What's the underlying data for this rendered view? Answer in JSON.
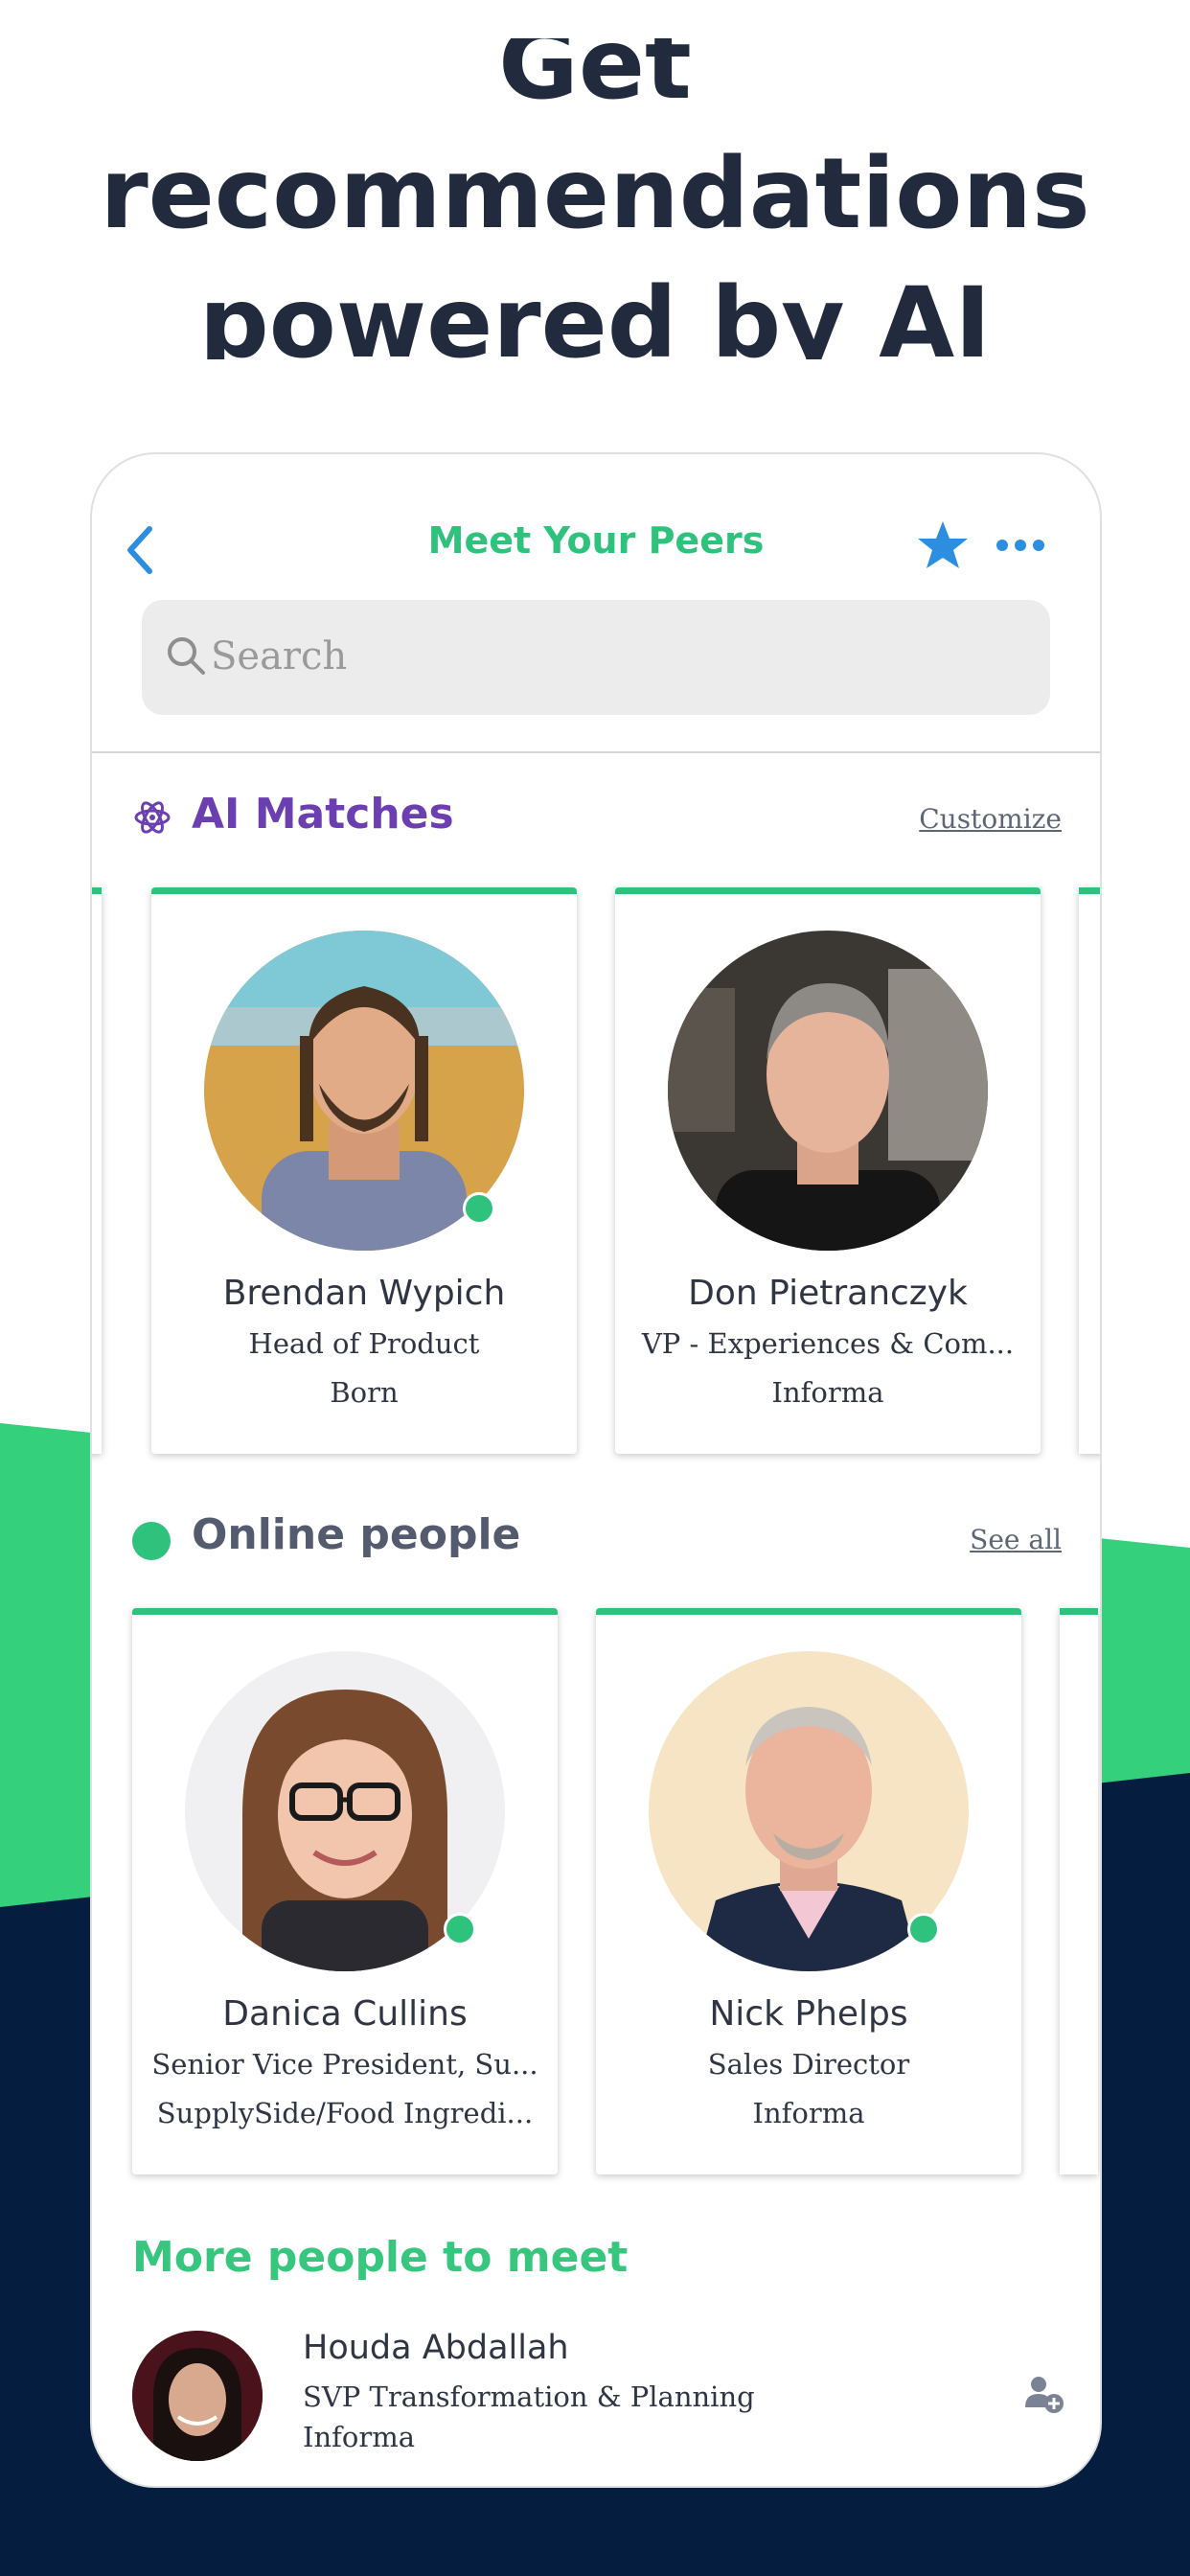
{
  "headline": {
    "line1": "Get",
    "line2": "recommendations",
    "line3": "powered by AI"
  },
  "nav": {
    "title": "Meet Your Peers"
  },
  "search": {
    "placeholder": "Search"
  },
  "ai_matches": {
    "title": "AI Matches",
    "link": "Customize",
    "cards": [
      {
        "name": "Brendan Wypich",
        "role": "Head of Product",
        "company": "Born",
        "online": true
      },
      {
        "name": "Don Pietranczyk",
        "role": "VP - Experiences & Com...",
        "company": "Informa",
        "online": false
      }
    ]
  },
  "online_people": {
    "title": "Online people",
    "link": "See all",
    "cards": [
      {
        "name": "Danica Cullins",
        "role": "Senior Vice President, Su...",
        "company": "SupplySide/Food Ingredi...",
        "online": true
      },
      {
        "name": "Nick Phelps",
        "role": "Sales Director",
        "company": "Informa",
        "online": true
      }
    ]
  },
  "more_people": {
    "title": "More people to meet",
    "people": [
      {
        "name": "Houda Abdallah",
        "role": "SVP Transformation & Planning",
        "company": "Informa"
      }
    ]
  },
  "colors": {
    "green": "#2fc27d",
    "purple": "#6b3fb0",
    "blue": "#2d8ee0",
    "navy": "#051e40",
    "text": "#2f3542"
  },
  "icons": [
    "chevron-left-icon",
    "star-icon",
    "more-icon",
    "search-icon",
    "atom-icon",
    "online-dot-icon",
    "add-user-icon"
  ]
}
